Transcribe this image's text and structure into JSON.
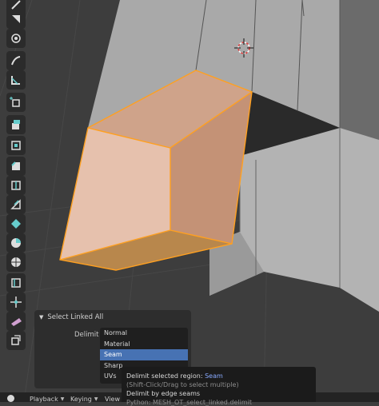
{
  "redo_panel": {
    "title": "Select Linked All",
    "delimit_label": "Delimit",
    "options": [
      "Normal",
      "Material",
      "Seam",
      "Sharp",
      "UVs"
    ],
    "selected": "Seam"
  },
  "tooltip": {
    "title_prefix": "Delimit selected region:",
    "title_value": "Seam",
    "hint": "(Shift-Click/Drag to select multiple)",
    "description": "Delimit by edge seams",
    "python": "Python: MESH_OT_select_linked.delimit"
  },
  "bottom_bar": {
    "playback": "Playback",
    "keying": "Keying",
    "view": "View"
  },
  "toolbar": {
    "tools": [
      "select-box-icon",
      "cursor-icon",
      "move-icon",
      "annotate-icon",
      "measure-icon",
      "add-cube-icon",
      "extrude-icon",
      "inset-icon",
      "bevel-icon",
      "loop-cut-icon",
      "knife-icon",
      "poly-build-icon",
      "spin-icon",
      "smooth-icon",
      "edge-slide-icon",
      "shrink-fatten-icon",
      "shear-icon",
      "rip-region-icon",
      "transform-icon"
    ]
  },
  "colors": {
    "selected_face": "#cfa38a",
    "selection_outline": "#ffa020",
    "accent_selected": "#4772b3"
  }
}
